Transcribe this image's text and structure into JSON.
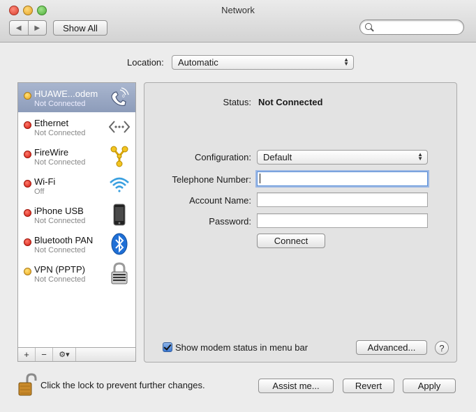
{
  "window": {
    "title": "Network"
  },
  "toolbar": {
    "back_label": "◀",
    "forward_label": "▶",
    "show_all_label": "Show All",
    "search_placeholder": ""
  },
  "location": {
    "label": "Location:",
    "value": "Automatic"
  },
  "services": [
    {
      "name": "HUAWE...odem",
      "status": "Not Connected",
      "indicator": "yellow",
      "icon": "modem-phone-icon",
      "selected": true
    },
    {
      "name": "Ethernet",
      "status": "Not Connected",
      "indicator": "red",
      "icon": "ethernet-icon"
    },
    {
      "name": "FireWire",
      "status": "Not Connected",
      "indicator": "red",
      "icon": "firewire-icon"
    },
    {
      "name": "Wi-Fi",
      "status": "Off",
      "indicator": "red",
      "icon": "wifi-icon"
    },
    {
      "name": "iPhone USB",
      "status": "Not Connected",
      "indicator": "red",
      "icon": "iphone-icon"
    },
    {
      "name": "Bluetooth PAN",
      "status": "Not Connected",
      "indicator": "red",
      "icon": "bluetooth-icon"
    },
    {
      "name": "VPN (PPTP)",
      "status": "Not Connected",
      "indicator": "yellow",
      "icon": "vpn-lock-icon"
    }
  ],
  "sidebar_toolbar": {
    "add_label": "+",
    "remove_label": "−",
    "gear_label": "⚙▾"
  },
  "detail": {
    "status_label": "Status:",
    "status_value": "Not Connected",
    "configuration_label": "Configuration:",
    "configuration_value": "Default",
    "telephone_label": "Telephone Number:",
    "telephone_value": "",
    "account_label": "Account Name:",
    "account_value": "",
    "password_label": "Password:",
    "password_value": "",
    "connect_label": "Connect",
    "show_modem_status_label": "Show modem status in menu bar",
    "show_modem_status_checked": true,
    "advanced_label": "Advanced...",
    "help_label": "?"
  },
  "footer": {
    "lock_text": "Click the lock to prevent further changes.",
    "assist_label": "Assist me...",
    "revert_label": "Revert",
    "apply_label": "Apply"
  },
  "colors": {
    "selection": "#8d9cba",
    "status_red": "#d21a10",
    "status_yellow": "#eca51a",
    "accent": "#3a78d3"
  }
}
